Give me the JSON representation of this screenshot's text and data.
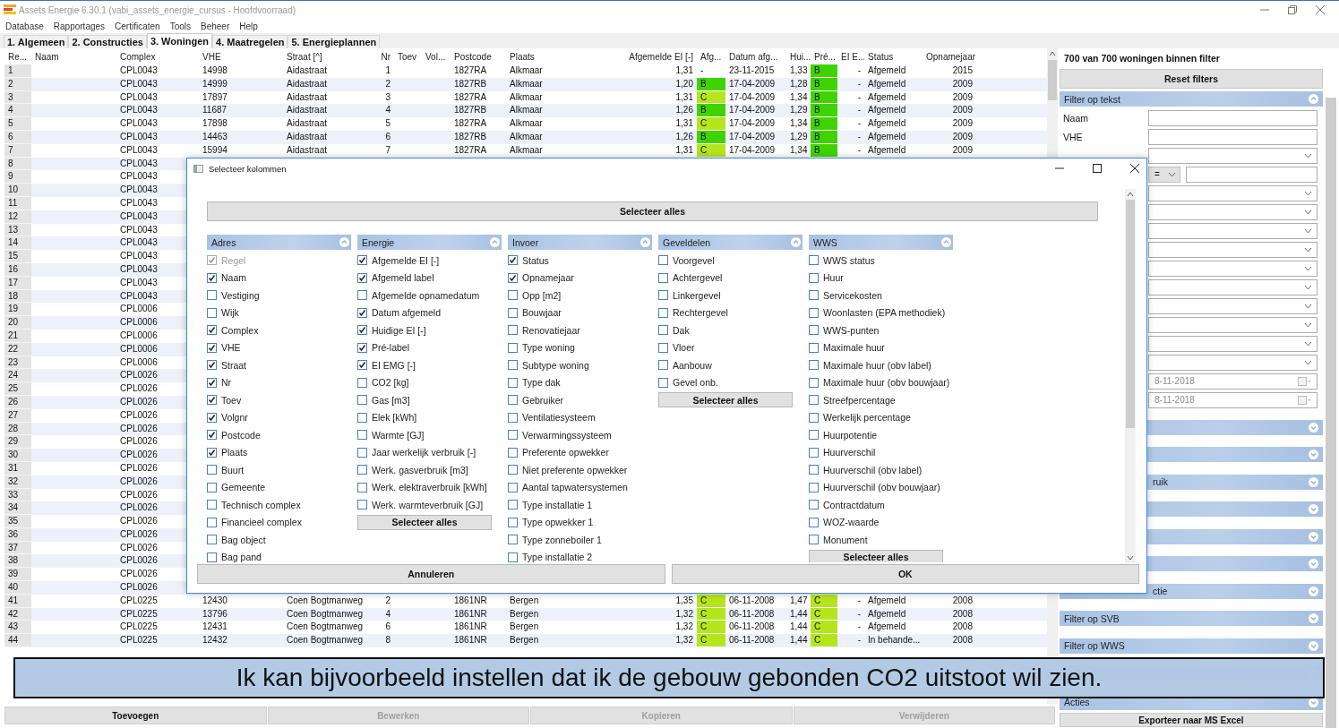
{
  "window": {
    "title": "Assets Energie 6.30.1 (vabi_assets_energie_cursus - Hoofdvoorraad)"
  },
  "menu": [
    "Database",
    "Rapportages",
    "Certificaten",
    "Tools",
    "Beheer",
    "Help"
  ],
  "tabs": [
    {
      "label": "1. Algemeen",
      "selected": false
    },
    {
      "label": "2. Constructies",
      "selected": false
    },
    {
      "label": "3. Woningen",
      "selected": true
    },
    {
      "label": "4. Maatregelen",
      "selected": false
    },
    {
      "label": "5. Energieplannen",
      "selected": false
    }
  ],
  "table": {
    "columns": [
      "Re...",
      "Naam",
      "Complex",
      "VHE",
      "Straat [^]",
      "Nr",
      "Toev",
      "Vol...",
      "Postcode",
      "Plaats",
      "Afgemelde EI [-]",
      "Afg...",
      "Datum afg...",
      "Hui...",
      "Pré...",
      "EI E...",
      "Status",
      "Opnamejaar"
    ],
    "rows": [
      {
        "nr": "1",
        "complex": "CPL0043",
        "vhe": "14998",
        "straat": "Aidastraat",
        "huisnr": "1",
        "postcode": "1827RA",
        "plaats": "Alkmaar",
        "afg_ei": "1,31",
        "afg_label": {
          "text": "-"
        },
        "datum": "23-11-2015",
        "hui_ei": "1,33",
        "pre_label": {
          "text": "B",
          "color": "#3fd400"
        },
        "ei_emg": "-",
        "status": "Afgemeld",
        "opnamejaar": "2015"
      },
      {
        "nr": "2",
        "complex": "CPL0043",
        "vhe": "14999",
        "straat": "Aidastraat",
        "huisnr": "2",
        "postcode": "1827RB",
        "plaats": "Alkmaar",
        "afg_ei": "1,20",
        "afg_label": {
          "text": "B",
          "color": "#3fd400"
        },
        "datum": "17-04-2009",
        "hui_ei": "1,28",
        "pre_label": {
          "text": "B",
          "color": "#3fd400"
        },
        "ei_emg": "-",
        "status": "Afgemeld",
        "opnamejaar": "2009"
      },
      {
        "nr": "3",
        "complex": "CPL0043",
        "vhe": "17897",
        "straat": "Aidastraat",
        "huisnr": "3",
        "postcode": "1827RA",
        "plaats": "Alkmaar",
        "afg_ei": "1,31",
        "afg_label": {
          "text": "C",
          "color": "#b5e61d"
        },
        "datum": "17-04-2009",
        "hui_ei": "1,34",
        "pre_label": {
          "text": "B",
          "color": "#3fd400"
        },
        "ei_emg": "-",
        "status": "Afgemeld",
        "opnamejaar": "2009"
      },
      {
        "nr": "4",
        "complex": "CPL0043",
        "vhe": "11687",
        "straat": "Aidastraat",
        "huisnr": "4",
        "postcode": "1827RB",
        "plaats": "Alkmaar",
        "afg_ei": "1,26",
        "afg_label": {
          "text": "B",
          "color": "#3fd400"
        },
        "datum": "17-04-2009",
        "hui_ei": "1,29",
        "pre_label": {
          "text": "B",
          "color": "#3fd400"
        },
        "ei_emg": "-",
        "status": "Afgemeld",
        "opnamejaar": "2009"
      },
      {
        "nr": "5",
        "complex": "CPL0043",
        "vhe": "17898",
        "straat": "Aidastraat",
        "huisnr": "5",
        "postcode": "1827RA",
        "plaats": "Alkmaar",
        "afg_ei": "1,31",
        "afg_label": {
          "text": "C",
          "color": "#b5e61d"
        },
        "datum": "17-04-2009",
        "hui_ei": "1,34",
        "pre_label": {
          "text": "B",
          "color": "#3fd400"
        },
        "ei_emg": "-",
        "status": "Afgemeld",
        "opnamejaar": "2009"
      },
      {
        "nr": "6",
        "complex": "CPL0043",
        "vhe": "14463",
        "straat": "Aidastraat",
        "huisnr": "6",
        "postcode": "1827RB",
        "plaats": "Alkmaar",
        "afg_ei": "1,26",
        "afg_label": {
          "text": "B",
          "color": "#3fd400"
        },
        "datum": "17-04-2009",
        "hui_ei": "1,29",
        "pre_label": {
          "text": "B",
          "color": "#3fd400"
        },
        "ei_emg": "-",
        "status": "Afgemeld",
        "opnamejaar": "2009"
      },
      {
        "nr": "7",
        "complex": "CPL0043",
        "vhe": "15994",
        "straat": "Aidastraat",
        "huisnr": "7",
        "postcode": "1827RA",
        "plaats": "Alkmaar",
        "afg_ei": "1,31",
        "afg_label": {
          "text": "C",
          "color": "#b5e61d"
        },
        "datum": "17-04-2009",
        "hui_ei": "1,34",
        "pre_label": {
          "text": "B",
          "color": "#3fd400"
        },
        "ei_emg": "-",
        "status": "Afgemeld",
        "opnamejaar": "2009"
      },
      {
        "nr": "8",
        "complex": "CPL0043"
      },
      {
        "nr": "9",
        "complex": "CPL0043"
      },
      {
        "nr": "10",
        "complex": "CPL0043"
      },
      {
        "nr": "11",
        "complex": "CPL0043"
      },
      {
        "nr": "12",
        "complex": "CPL0043"
      },
      {
        "nr": "13",
        "complex": "CPL0043"
      },
      {
        "nr": "14",
        "complex": "CPL0043"
      },
      {
        "nr": "15",
        "complex": "CPL0043"
      },
      {
        "nr": "16",
        "complex": "CPL0043"
      },
      {
        "nr": "17",
        "complex": "CPL0043"
      },
      {
        "nr": "18",
        "complex": "CPL0043"
      },
      {
        "nr": "19",
        "complex": "CPL0006"
      },
      {
        "nr": "20",
        "complex": "CPL0006"
      },
      {
        "nr": "21",
        "complex": "CPL0006"
      },
      {
        "nr": "22",
        "complex": "CPL0006"
      },
      {
        "nr": "23",
        "complex": "CPL0006"
      },
      {
        "nr": "24",
        "complex": "CPL0026"
      },
      {
        "nr": "25",
        "complex": "CPL0026"
      },
      {
        "nr": "26",
        "complex": "CPL0026"
      },
      {
        "nr": "27",
        "complex": "CPL0026"
      },
      {
        "nr": "28",
        "complex": "CPL0026"
      },
      {
        "nr": "29",
        "complex": "CPL0026"
      },
      {
        "nr": "30",
        "complex": "CPL0026"
      },
      {
        "nr": "31",
        "complex": "CPL0026"
      },
      {
        "nr": "32",
        "complex": "CPL0026"
      },
      {
        "nr": "33",
        "complex": "CPL0026"
      },
      {
        "nr": "34",
        "complex": "CPL0026"
      },
      {
        "nr": "35",
        "complex": "CPL0026"
      },
      {
        "nr": "36",
        "complex": "CPL0026"
      },
      {
        "nr": "37",
        "complex": "CPL0026"
      },
      {
        "nr": "38",
        "complex": "CPL0026"
      },
      {
        "nr": "39",
        "complex": "CPL0026"
      },
      {
        "nr": "40",
        "complex": "CPL0026"
      },
      {
        "nr": "41",
        "complex": "CPL0225",
        "vhe": "12430",
        "straat": "Coen Bogtmanweg",
        "huisnr": "2",
        "postcode": "1861NR",
        "plaats": "Bergen",
        "afg_ei": "1,35",
        "afg_label": {
          "text": "C",
          "color": "#b5e61d"
        },
        "datum": "06-11-2008",
        "hui_ei": "1,47",
        "pre_label": {
          "text": "C",
          "color": "#b5e61d"
        },
        "ei_emg": "-",
        "status": "Afgemeld",
        "opnamejaar": "2008"
      },
      {
        "nr": "42",
        "complex": "CPL0225",
        "vhe": "13796",
        "straat": "Coen Bogtmanweg",
        "huisnr": "4",
        "postcode": "1861NR",
        "plaats": "Bergen",
        "afg_ei": "1,32",
        "afg_label": {
          "text": "C",
          "color": "#b5e61d"
        },
        "datum": "06-11-2008",
        "hui_ei": "1,44",
        "pre_label": {
          "text": "C",
          "color": "#b5e61d"
        },
        "ei_emg": "-",
        "status": "Afgemeld",
        "opnamejaar": "2008"
      },
      {
        "nr": "43",
        "complex": "CPL0225",
        "vhe": "12431",
        "straat": "Coen Bogtmanweg",
        "huisnr": "6",
        "postcode": "1861NR",
        "plaats": "Bergen",
        "afg_ei": "1,32",
        "afg_label": {
          "text": "C",
          "color": "#b5e61d"
        },
        "datum": "06-11-2008",
        "hui_ei": "1,44",
        "pre_label": {
          "text": "C",
          "color": "#b5e61d"
        },
        "ei_emg": "-",
        "status": "Afgemeld",
        "opnamejaar": "2008"
      },
      {
        "nr": "44",
        "complex": "CPL0225",
        "vhe": "12432",
        "straat": "Coen Bogtmanweg",
        "huisnr": "8",
        "postcode": "1861NR",
        "plaats": "Bergen",
        "afg_ei": "1,32",
        "afg_label": {
          "text": "C",
          "color": "#b5e61d"
        },
        "datum": "06-11-2008",
        "hui_ei": "1,44",
        "pre_label": {
          "text": "C",
          "color": "#b5e61d"
        },
        "ei_emg": "-",
        "status": "In behande...",
        "opnamejaar": "2008"
      }
    ]
  },
  "actions": [
    {
      "label": "Toevoegen",
      "disabled": false
    },
    {
      "label": "Bewerken",
      "disabled": true
    },
    {
      "label": "Kopieren",
      "disabled": true
    },
    {
      "label": "Verwijderen",
      "disabled": true
    }
  ],
  "filter_panel": {
    "count": "700 van 700 woningen binnen filter",
    "reset": "Reset filters",
    "sections": [
      {
        "title": "Filter op tekst",
        "expanded": true,
        "covered": false,
        "fields": [
          {
            "kind": "text",
            "label": "Naam"
          },
          {
            "kind": "text",
            "label": "VHE"
          },
          {
            "kind": "dropdown"
          },
          {
            "kind": "operator",
            "operator": "="
          },
          {
            "kind": "dropdown"
          },
          {
            "kind": "dropdown"
          },
          {
            "kind": "dropdown"
          },
          {
            "kind": "dropdown"
          },
          {
            "kind": "dropdown"
          },
          {
            "kind": "dropdown"
          },
          {
            "kind": "dropdown"
          },
          {
            "kind": "dropdown"
          },
          {
            "kind": "dropdown"
          },
          {
            "kind": "dropdown"
          },
          {
            "kind": "date",
            "value": "8-11-2018"
          },
          {
            "kind": "date",
            "value": "8-11-2018"
          }
        ]
      },
      {
        "expanded": false
      },
      {
        "expanded": false
      },
      {
        "title": "ruik",
        "expanded": false,
        "covered": true
      },
      {
        "expanded": false
      },
      {
        "expanded": false
      },
      {
        "expanded": false
      },
      {
        "title": "ctie",
        "expanded": false,
        "covered": true
      },
      {
        "title": "Filter op SVB",
        "expanded": false,
        "covered": false
      },
      {
        "title": "Filter op WWS",
        "expanded": false,
        "covered": false
      },
      {
        "expanded": false
      },
      {
        "title": "Acties",
        "expanded": false
      }
    ],
    "export": "Exporteer naar MS Excel"
  },
  "dialog": {
    "title": "Selecteer kolommen",
    "select_all": "Selecteer alles",
    "groups": [
      {
        "title": "Adres",
        "expanded": true,
        "items": [
          {
            "label": "Regel",
            "checked": true,
            "disabled": true
          },
          {
            "label": "Naam",
            "checked": true,
            "disabled": false
          },
          {
            "label": "Vestiging",
            "checked": false,
            "disabled": false
          },
          {
            "label": "Wijk",
            "checked": false,
            "disabled": false
          },
          {
            "label": "Complex",
            "checked": true,
            "disabled": false
          },
          {
            "label": "VHE",
            "checked": true,
            "disabled": false
          },
          {
            "label": "Straat",
            "checked": true,
            "disabled": false
          },
          {
            "label": "Nr",
            "checked": true,
            "disabled": false
          },
          {
            "label": "Toev",
            "checked": true,
            "disabled": false
          },
          {
            "label": "Volgnr",
            "checked": true,
            "disabled": false
          },
          {
            "label": "Postcode",
            "checked": true,
            "disabled": false
          },
          {
            "label": "Plaats",
            "checked": true,
            "disabled": false
          },
          {
            "label": "Buurt",
            "checked": false,
            "disabled": false
          },
          {
            "label": "Gemeente",
            "checked": false,
            "disabled": false
          },
          {
            "label": "Technisch complex",
            "checked": false,
            "disabled": false
          },
          {
            "label": "Financieel complex",
            "checked": false,
            "disabled": false
          },
          {
            "label": "Bag object",
            "checked": false,
            "disabled": false
          },
          {
            "label": "Bag pand",
            "checked": false,
            "disabled": false
          }
        ]
      },
      {
        "title": "Energie",
        "expanded": true,
        "button": "Selecteer alles",
        "items": [
          {
            "label": "Afgemelde EI [-]",
            "checked": true,
            "disabled": false
          },
          {
            "label": "Afgemeld label",
            "checked": true,
            "disabled": false
          },
          {
            "label": "Afgemelde opnamedatum",
            "checked": false,
            "disabled": false
          },
          {
            "label": "Datum afgemeld",
            "checked": true,
            "disabled": false
          },
          {
            "label": "Huidige EI [-]",
            "checked": true,
            "disabled": false
          },
          {
            "label": "Pré-label",
            "checked": true,
            "disabled": false
          },
          {
            "label": "EI EMG [-]",
            "checked": true,
            "disabled": false
          },
          {
            "label": "CO2 [kg]",
            "checked": false,
            "disabled": false
          },
          {
            "label": "Gas [m3]",
            "checked": false,
            "disabled": false
          },
          {
            "label": "Elek [kWh]",
            "checked": false,
            "disabled": false
          },
          {
            "label": "Warmte [GJ]",
            "checked": false,
            "disabled": false
          },
          {
            "label": "Jaar werkelijk verbruik [-]",
            "checked": false,
            "disabled": false
          },
          {
            "label": "Werk. gasverbruik [m3]",
            "checked": false,
            "disabled": false
          },
          {
            "label": "Werk. elektraverbruik [kWh]",
            "checked": false,
            "disabled": false
          },
          {
            "label": "Werk. warmteverbruik [GJ]",
            "checked": false,
            "disabled": false
          }
        ]
      },
      {
        "title": "Invoer",
        "expanded": true,
        "items": [
          {
            "label": "Status",
            "checked": true,
            "disabled": false
          },
          {
            "label": "Opnamejaar",
            "checked": true,
            "disabled": false
          },
          {
            "label": "Opp [m2]",
            "checked": false,
            "disabled": false
          },
          {
            "label": "Bouwjaar",
            "checked": false,
            "disabled": false
          },
          {
            "label": "Renovatiejaar",
            "checked": false,
            "disabled": false
          },
          {
            "label": "Type woning",
            "checked": false,
            "disabled": false
          },
          {
            "label": "Subtype woning",
            "checked": false,
            "disabled": false
          },
          {
            "label": "Type dak",
            "checked": false,
            "disabled": false
          },
          {
            "label": "Gebruiker",
            "checked": false,
            "disabled": false
          },
          {
            "label": "Ventilatiesysteem",
            "checked": false,
            "disabled": false
          },
          {
            "label": "Verwarmingssysteem",
            "checked": false,
            "disabled": false
          },
          {
            "label": "Preferente opwekker",
            "checked": false,
            "disabled": false
          },
          {
            "label": "Niet preferente opwekker",
            "checked": false,
            "disabled": false
          },
          {
            "label": "Aantal tapwatersystemen",
            "checked": false,
            "disabled": false
          },
          {
            "label": "Type installatie 1",
            "checked": false,
            "disabled": false
          },
          {
            "label": "Type opwekker 1",
            "checked": false,
            "disabled": false
          },
          {
            "label": "Type zonneboiler 1",
            "checked": false,
            "disabled": false
          },
          {
            "label": "Type installatie 2",
            "checked": false,
            "disabled": false
          }
        ]
      },
      {
        "title": "Geveldelen",
        "expanded": true,
        "button": "Selecteer alles",
        "items": [
          {
            "label": "Voorgevel",
            "checked": false,
            "disabled": false
          },
          {
            "label": "Achtergevel",
            "checked": false,
            "disabled": false
          },
          {
            "label": "Linkergevel",
            "checked": false,
            "disabled": false
          },
          {
            "label": "Rechtergevel",
            "checked": false,
            "disabled": false
          },
          {
            "label": "Dak",
            "checked": false,
            "disabled": false
          },
          {
            "label": "Vloer",
            "checked": false,
            "disabled": false
          },
          {
            "label": "Aanbouw",
            "checked": false,
            "disabled": false
          },
          {
            "label": "Gevel onb.",
            "checked": false,
            "disabled": false
          }
        ]
      },
      {
        "title": "WWS",
        "expanded": true,
        "button": "Selecteer alles",
        "items": [
          {
            "label": "WWS status",
            "checked": false,
            "disabled": false
          },
          {
            "label": "Huur",
            "checked": false,
            "disabled": false
          },
          {
            "label": "Servicekosten",
            "checked": false,
            "disabled": false
          },
          {
            "label": "Woonlasten (EPA methodiek)",
            "checked": false,
            "disabled": false
          },
          {
            "label": "WWS-punten",
            "checked": false,
            "disabled": false
          },
          {
            "label": "Maximale huur",
            "checked": false,
            "disabled": false
          },
          {
            "label": "Maximale huur (obv label)",
            "checked": false,
            "disabled": false
          },
          {
            "label": "Maximale huur (obv bouwjaar)",
            "checked": false,
            "disabled": false
          },
          {
            "label": "Streefpercentage",
            "checked": false,
            "disabled": false
          },
          {
            "label": "Werkelijk percentage",
            "checked": false,
            "disabled": false
          },
          {
            "label": "Huurpotentie",
            "checked": false,
            "disabled": false
          },
          {
            "label": "Huurverschil",
            "checked": false,
            "disabled": false
          },
          {
            "label": "Huurverschil (obv label)",
            "checked": false,
            "disabled": false
          },
          {
            "label": "Huurverschil (obv bouwjaar)",
            "checked": false,
            "disabled": false
          },
          {
            "label": "Contractdatum",
            "checked": false,
            "disabled": false
          },
          {
            "label": "WOZ-waarde",
            "checked": false,
            "disabled": false
          },
          {
            "label": "Monument",
            "checked": false,
            "disabled": false
          }
        ]
      }
    ],
    "buttons": [
      "Annuleren",
      "OK"
    ]
  },
  "caption": "Ik kan bijvoorbeeld instellen dat ik de gebouw gebonden CO2 uitstoot wil zien."
}
